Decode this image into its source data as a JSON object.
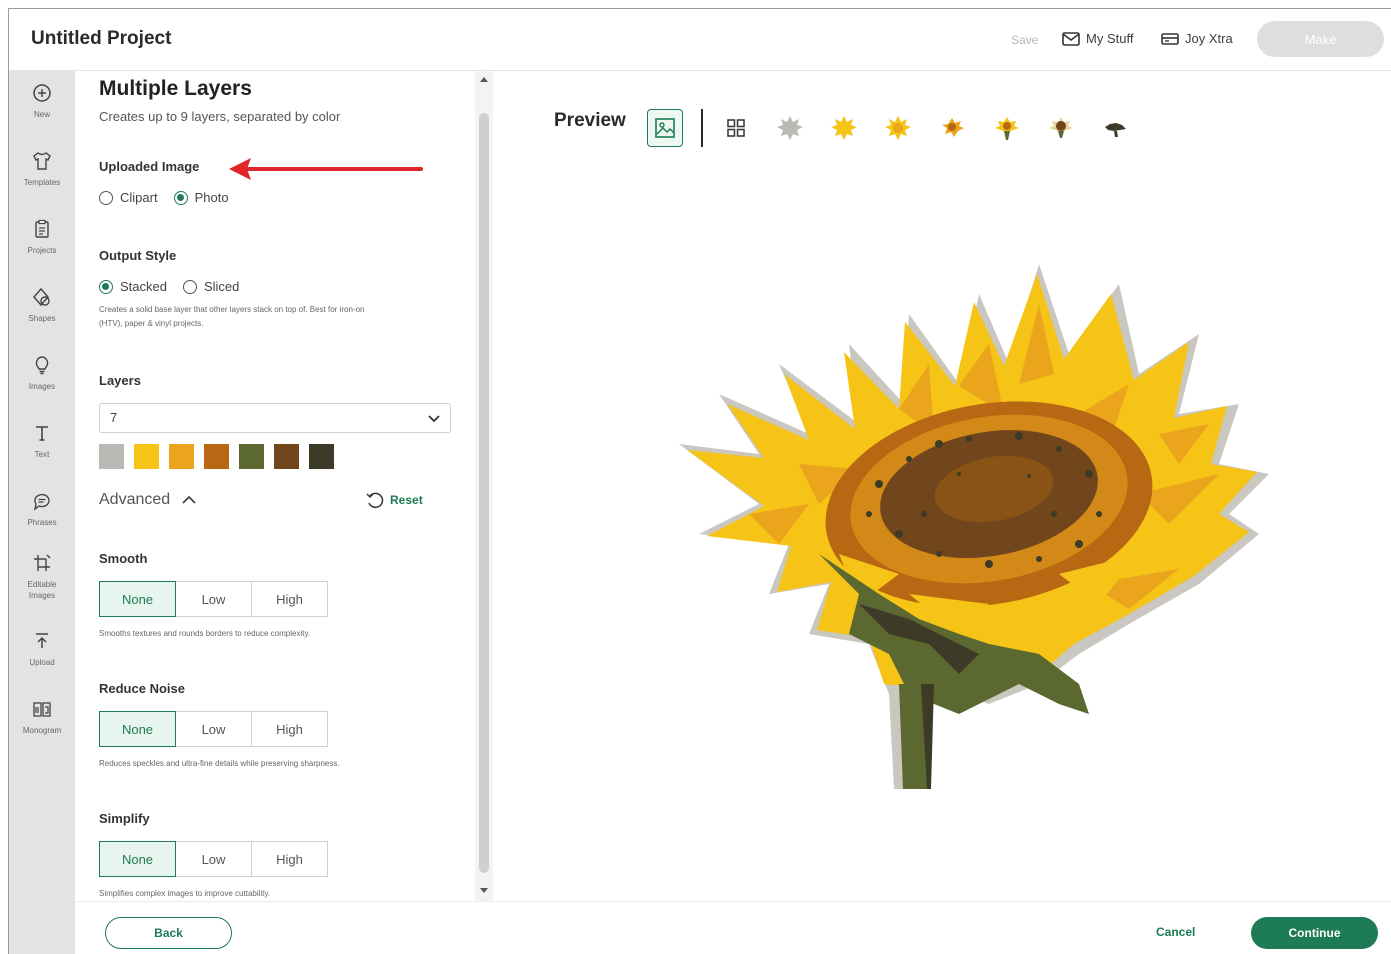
{
  "header": {
    "title": "Untitled Project",
    "save_label": "Save",
    "my_stuff_label": "My Stuff",
    "joy_xtra_label": "Joy Xtra",
    "make_label": "Make"
  },
  "rail": {
    "items": [
      {
        "label": "New",
        "icon": "plus-circle-icon"
      },
      {
        "label": "Templates",
        "icon": "shirt-icon"
      },
      {
        "label": "Projects",
        "icon": "clipboard-icon"
      },
      {
        "label": "Shapes",
        "icon": "shapes-icon"
      },
      {
        "label": "Images",
        "icon": "lightbulb-icon"
      },
      {
        "label": "Text",
        "icon": "text-icon"
      },
      {
        "label": "Phrases",
        "icon": "speech-bubble-icon"
      },
      {
        "label": "Editable Images",
        "icon": "editable-images-icon"
      },
      {
        "label": "Upload",
        "icon": "upload-icon"
      },
      {
        "label": "Monogram",
        "icon": "monogram-icon"
      }
    ]
  },
  "panel": {
    "title": "Multiple Layers",
    "subtitle": "Creates up to 9 layers, separated by color",
    "uploaded_image": {
      "label": "Uploaded Image",
      "options": [
        "Clipart",
        "Photo"
      ],
      "selected": "Photo"
    },
    "output_style": {
      "label": "Output Style",
      "options": [
        "Stacked",
        "Sliced"
      ],
      "selected": "Stacked",
      "help_line1": "Creates a solid base layer that other layers stack on top of. Best for iron-on",
      "help_line2": "(HTV), paper & vinyl projects."
    },
    "layers": {
      "label": "Layers",
      "value": "7",
      "colors": [
        "#b9b9b5",
        "#f5c417",
        "#eaa51c",
        "#b86713",
        "#5b6830",
        "#71461c",
        "#3d3b28"
      ]
    },
    "advanced_label": "Advanced",
    "reset_label": "Reset",
    "smooth": {
      "label": "Smooth",
      "options": [
        "None",
        "Low",
        "High"
      ],
      "selected": "None",
      "help": "Smooths textures and rounds borders to reduce complexity."
    },
    "reduce_noise": {
      "label": "Reduce Noise",
      "options": [
        "None",
        "Low",
        "High"
      ],
      "selected": "None",
      "help": "Reduces speckles and ultra-fine details while preserving sharpness."
    },
    "simplify": {
      "label": "Simplify",
      "options": [
        "None",
        "Low",
        "High"
      ],
      "selected": "None",
      "help": "Simplifies complex images to improve cuttability."
    }
  },
  "preview": {
    "label": "Preview",
    "thumbnails": [
      "image-view-icon",
      "grid-view-icon",
      "layer-1-thumbnail",
      "layer-2-thumbnail",
      "layer-3-thumbnail",
      "layer-4-thumbnail",
      "layer-5-thumbnail",
      "layer-6-thumbnail",
      "layer-7-thumbnail"
    ],
    "accent_color": "#1d7c55"
  },
  "footer": {
    "back_label": "Back",
    "cancel_label": "Cancel",
    "continue_label": "Continue"
  }
}
